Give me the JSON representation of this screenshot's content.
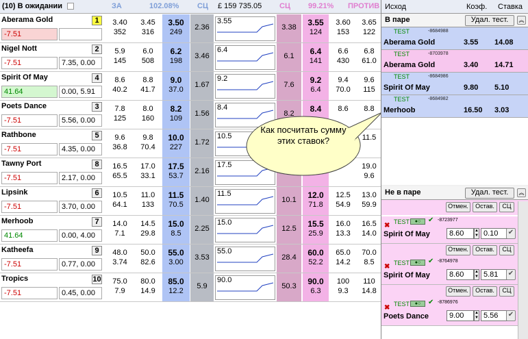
{
  "header": {
    "title": "(10) В ожидании",
    "za": "ЗА",
    "za_pct": "102.08%",
    "sc1": "СЦ",
    "bank": "£ 159 735.05",
    "sc2": "СЦ",
    "pr_pct": "99.21%",
    "pr": "ПРОТИВ"
  },
  "rows": [
    {
      "name": "Aberama Gold",
      "num": "1",
      "pl": "-7.51",
      "ex": "",
      "b1": "3.40",
      "b1s": "352",
      "b2": "3.45",
      "b2s": "316",
      "b3": "3.50",
      "b3s": "249",
      "sc": "2.36",
      "ch": "3.55",
      "sc2": "3.38",
      "l1": "3.55",
      "l1s": "124",
      "l2": "3.60",
      "l2s": "153",
      "l3": "3.65",
      "l3s": "122",
      "plc": "red",
      "hl": "#f9d4d4"
    },
    {
      "name": "Nigel Nott",
      "num": "2",
      "pl": "-7.51",
      "ex": "7.35, 0.00",
      "b1": "5.9",
      "b1s": "145",
      "b2": "6.0",
      "b2s": "508",
      "b3": "6.2",
      "b3s": "198",
      "sc": "3.46",
      "ch": "6.4",
      "sc2": "6.1",
      "l1": "6.4",
      "l1s": "141",
      "l2": "6.6",
      "l2s": "430",
      "l3": "6.8",
      "l3s": "61.0",
      "plc": "red"
    },
    {
      "name": "Spirit Of May",
      "num": "4",
      "pl": "41.64",
      "ex": "0.00, 5.91",
      "b1": "8.6",
      "b1s": "40.2",
      "b2": "8.8",
      "b2s": "41.7",
      "b3": "9.0",
      "b3s": "37.0",
      "sc": "1.67",
      "ch": "9.2",
      "sc2": "7.6",
      "l1": "9.2",
      "l1s": "6.4",
      "l2": "9.4",
      "l2s": "70.0",
      "l3": "9.6",
      "l3s": "115",
      "plc": "green",
      "hl": "#d4f7d0"
    },
    {
      "name": "Poets Dance",
      "num": "3",
      "pl": "-7.51",
      "ex": "5.56, 0.00",
      "b1": "7.8",
      "b1s": "125",
      "b2": "8.0",
      "b2s": "160",
      "b3": "8.2",
      "b3s": "109",
      "sc": "1.56",
      "ch": "8.4",
      "sc2": "8.2",
      "l1": "8.4",
      "l1s": "",
      "l2": "8.6",
      "l2s": "",
      "l3": "8.8",
      "l3s": "",
      "plc": "red"
    },
    {
      "name": "Rathbone",
      "num": "5",
      "pl": "-7.51",
      "ex": "4.35, 0.00",
      "b1": "9.6",
      "b1s": "36.8",
      "b2": "9.8",
      "b2s": "70.4",
      "b3": "10.0",
      "b3s": "227",
      "sc": "1.72",
      "ch": "10.5",
      "sc2": "",
      "l1": "",
      "l1s": "",
      "l2": "",
      "l2s": "",
      "l3": "11.5",
      "l3s": "",
      "plc": "red"
    },
    {
      "name": "Tawny Port",
      "num": "8",
      "pl": "-7.51",
      "ex": "2.17, 0.00",
      "b1": "16.5",
      "b1s": "65.5",
      "b2": "17.0",
      "b2s": "33.1",
      "b3": "17.5",
      "b3s": "53.7",
      "sc": "2.16",
      "ch": "17.5",
      "sc2": "",
      "l1": "",
      "l1s": "",
      "l2": "",
      "l2s": "",
      "l3": "19.0",
      "l3s": "9.6",
      "plc": "red"
    },
    {
      "name": "Lipsink",
      "num": "6",
      "pl": "-7.51",
      "ex": "3.70, 0.00",
      "b1": "10.5",
      "b1s": "64.1",
      "b2": "11.0",
      "b2s": "133",
      "b3": "11.5",
      "b3s": "70.5",
      "sc": "1.40",
      "ch": "11.5",
      "sc2": "10.1",
      "l1": "12.0",
      "l1s": "71.8",
      "l2": "12.5",
      "l2s": "54.9",
      "l3": "13.0",
      "l3s": "59.9",
      "plc": "red"
    },
    {
      "name": "Merhoob",
      "num": "7",
      "pl": "41.64",
      "ex": "0.00, 4.00",
      "b1": "14.0",
      "b1s": "7.1",
      "b2": "14.5",
      "b2s": "29.8",
      "b3": "15.0",
      "b3s": "8.5",
      "sc": "2.25",
      "ch": "15.0",
      "sc2": "12.5",
      "l1": "15.5",
      "l1s": "25.9",
      "l2": "16.0",
      "l2s": "13.3",
      "l3": "16.5",
      "l3s": "14.0",
      "plc": "green"
    },
    {
      "name": "Katheefa",
      "num": "9",
      "pl": "-7.51",
      "ex": "0.77, 0.00",
      "b1": "48.0",
      "b1s": "3.74",
      "b2": "50.0",
      "b2s": "82.6",
      "b3": "55.0",
      "b3s": "3.00",
      "sc": "3.53",
      "ch": "55.0",
      "sc2": "28.4",
      "l1": "60.0",
      "l1s": "52.2",
      "l2": "65.0",
      "l2s": "14.2",
      "l3": "70.0",
      "l3s": "8.5",
      "plc": "red"
    },
    {
      "name": "Tropics",
      "num": "10",
      "pl": "-7.51",
      "ex": "0.45, 0.00",
      "b1": "75.0",
      "b1s": "7.9",
      "b2": "80.0",
      "b2s": "14.9",
      "b3": "85.0",
      "b3s": "12.2",
      "sc": "5.9",
      "ch": "90.0",
      "sc2": "50.3",
      "l1": "90.0",
      "l1s": "6.3",
      "l2": "100",
      "l2s": "9.3",
      "l3": "110",
      "l3s": "14.8",
      "plc": "red"
    }
  ],
  "bubble": "Как посчитать сумму этих ставок?",
  "right": {
    "col_outcome": "Исход",
    "col_odds": "Коэф.",
    "col_stake": "Ставка",
    "matched_title": "В паре",
    "matched_btn": "Удал. тест.",
    "matched": [
      {
        "test": "TEST",
        "id": "-8684988",
        "horse": "Aberama Gold",
        "odds": "3.55",
        "stake": "14.08",
        "bg": "#c7d4f7"
      },
      {
        "test": "TEST",
        "id": "-8703978",
        "horse": "Aberama Gold",
        "odds": "3.40",
        "stake": "14.71",
        "bg": "#f7c7ee"
      },
      {
        "test": "TEST",
        "id": "-8684986",
        "horse": "Spirit Of May",
        "odds": "9.80",
        "stake": "5.10",
        "bg": "#c7d4f7"
      },
      {
        "test": "TEST",
        "id": "-8684982",
        "horse": "Merhoob",
        "odds": "16.50",
        "stake": "3.03",
        "bg": "#c7d4f7"
      }
    ],
    "unmatched_title": "Не в паре",
    "unmatched_btn": "Удал. тест.",
    "actions": {
      "cancel": "Отмен.",
      "keep": "Остав.",
      "sc": "СЦ"
    },
    "unmatched": [
      {
        "test": "TEST",
        "id": "-8723977",
        "horse": "Spirit Of May",
        "odds": "8.60",
        "stake": "0.10"
      },
      {
        "test": "TEST",
        "id": "-8764978",
        "horse": "Spirit Of May",
        "odds": "8.60",
        "stake": "5.81"
      },
      {
        "test": "TEST",
        "id": "-8786976",
        "horse": "Poets Dance",
        "odds": "9.00",
        "stake": "5.56"
      }
    ]
  }
}
